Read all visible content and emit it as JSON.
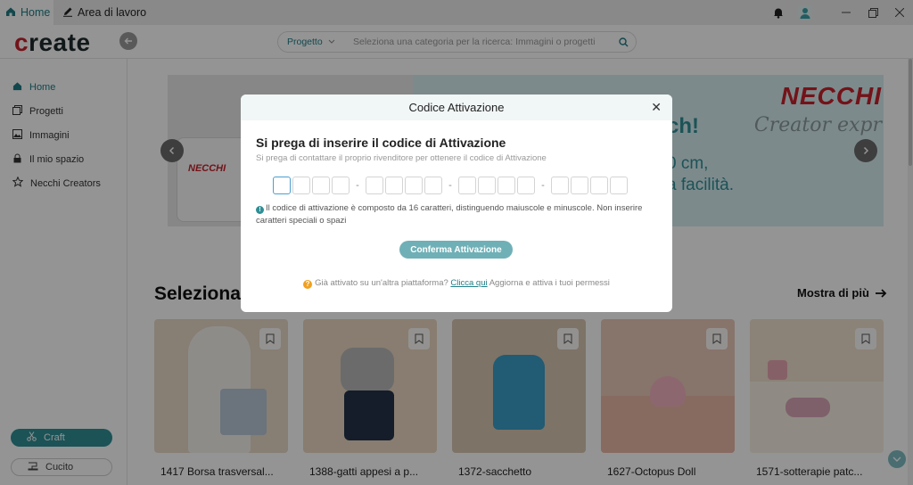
{
  "titlebar": {
    "tabs": [
      {
        "label": "Home",
        "icon": "home-icon"
      },
      {
        "label": "Area di lavoro",
        "icon": "pen-icon"
      }
    ]
  },
  "header": {
    "logo": "create",
    "search": {
      "category": "Progetto",
      "placeholder": "Seleziona una categoria per la ricerca: Immagini o progetti"
    }
  },
  "sidebar": {
    "items": [
      {
        "label": "Home",
        "icon": "home-icon"
      },
      {
        "label": "Progetti",
        "icon": "projects-icon"
      },
      {
        "label": "Immagini",
        "icon": "image-icon"
      },
      {
        "label": "Il mio spazio",
        "icon": "lock-icon"
      },
      {
        "label": "Necchi Creators",
        "icon": "star-icon"
      }
    ],
    "craft_label": "Craft",
    "cucito_label": "Cucito"
  },
  "banner": {
    "brand": "NECCHI",
    "script": "Creator expr",
    "headline": "ch!",
    "line1": "0 cm,",
    "line2": "a facilità.",
    "machine_logo": "NECCHI"
  },
  "section": {
    "title": "Seleziona",
    "more_label": "Mostra di più"
  },
  "cards": [
    {
      "title": "1417 Borsa trasversal...",
      "color": "#e9d9c8"
    },
    {
      "title": "1388-gatti appesi a p...",
      "color": "#ead8c2"
    },
    {
      "title": "1372-sacchetto",
      "color": "#d9c7b2"
    },
    {
      "title": "1627-Octopus Doll",
      "color": "#e8c9b8"
    },
    {
      "title": "1571-sotterapie patc...",
      "color": "#efe0cf"
    }
  ],
  "modal": {
    "title": "Codice Attivazione",
    "heading": "Si prega di inserire il codice di Attivazione",
    "subtitle": "Si prega di contattare il proprio rivenditore per ottenere il codice di Attivazione",
    "separator": "-",
    "info": "Il codice di attivazione è composto da 16 caratteri, distinguendo maiuscole e minuscole. Non inserire caratteri speciali o spazi",
    "confirm_label": "Conferma Attivazione",
    "footer_prefix": "Già attivato su un'altra piattaforma?",
    "footer_link": "Clicca qui",
    "footer_suffix": "Aggiorna e attiva i tuoi permessi"
  },
  "colors": {
    "accent": "#2f8f96",
    "brand_red": "#c6212c"
  }
}
